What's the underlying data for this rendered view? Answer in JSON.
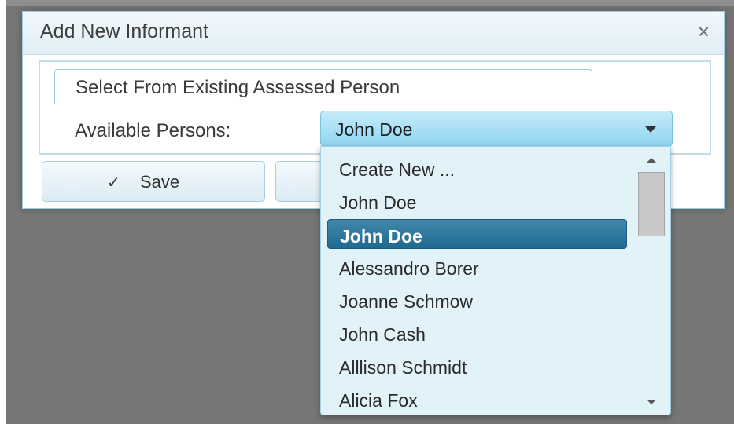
{
  "dialog": {
    "title": "Add New Informant",
    "close_symbol": "×",
    "tab_label": "Select From Existing Assessed Person",
    "field_label": "Available Persons:",
    "selected_value": "John Doe",
    "save_label": "Save",
    "save_icon": "check-icon"
  },
  "dropdown": {
    "options": [
      "Create New ...",
      "John Doe",
      "John Doe",
      "Alessandro Borer",
      "Joanne Schmow",
      "John Cash",
      "Alllison Schmidt",
      "Alicia Fox"
    ],
    "highlighted_index": 2
  },
  "colors": {
    "highlight": "#1f6a91",
    "select_bg": "#8fd3f0",
    "overlay": "#767676"
  }
}
